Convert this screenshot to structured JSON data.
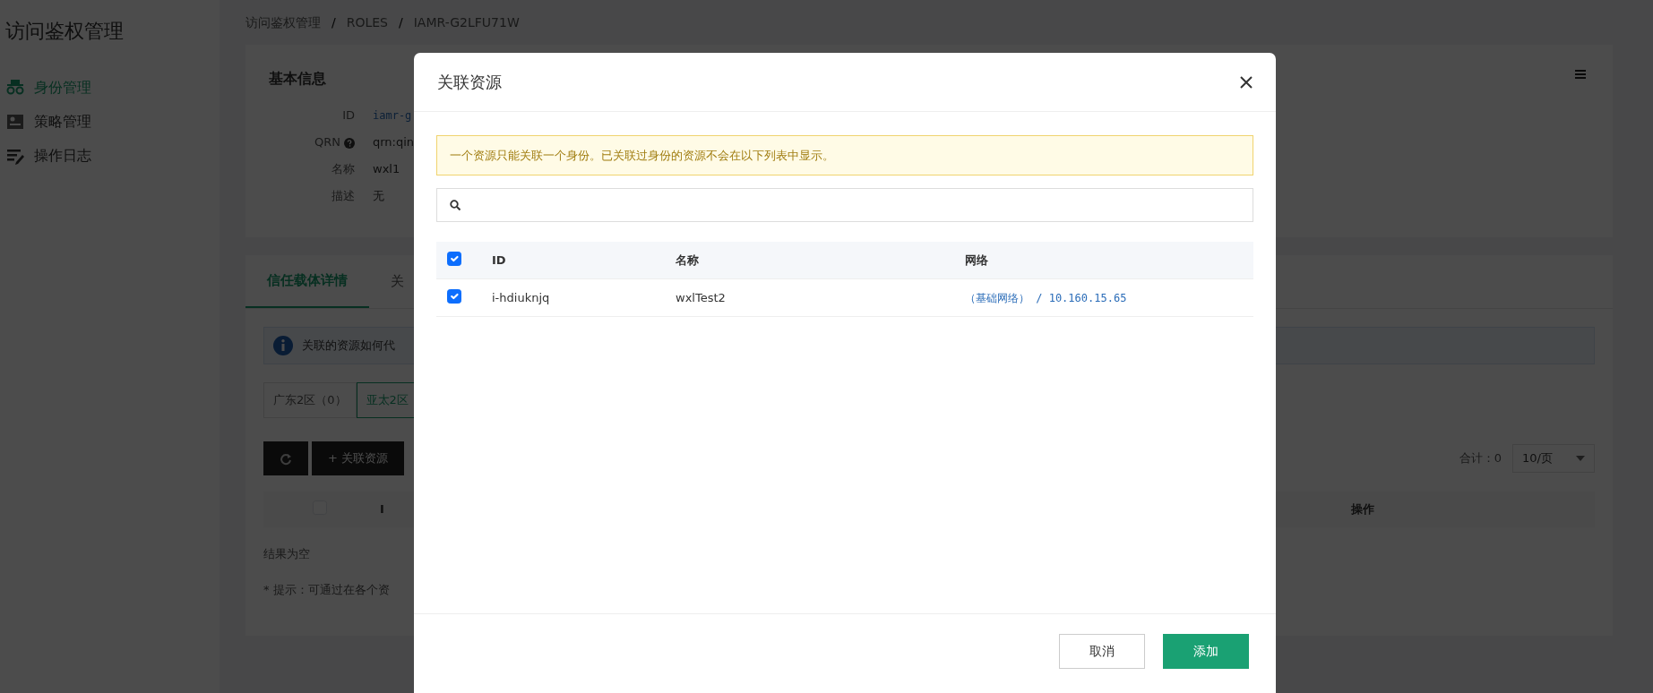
{
  "sidebar": {
    "title": "访问鉴权管理",
    "items": [
      {
        "label": "身份管理",
        "kind": "identity",
        "selected": true
      },
      {
        "label": "策略管理",
        "kind": "policy",
        "selected": false
      },
      {
        "label": "操作日志",
        "kind": "log",
        "selected": false
      }
    ]
  },
  "breadcrumb": [
    {
      "text": "访问鉴权管理",
      "kind": "link"
    },
    {
      "text": "/",
      "kind": "separator"
    },
    {
      "text": "ROLES",
      "kind": "link"
    },
    {
      "text": "/",
      "kind": "separator"
    },
    {
      "text": "IAMR-G2LFU71W",
      "kind": "link"
    }
  ],
  "basic_info": {
    "title": "基本信息",
    "fields": [
      {
        "label": "ID",
        "value": "iamr-g",
        "kind": "mono",
        "help": false
      },
      {
        "label": "QRN",
        "value": "qrn:qin",
        "kind": "plain",
        "help": true
      },
      {
        "label": "名称",
        "value": "wxl1",
        "kind": "plain",
        "help": false
      },
      {
        "label": "描述",
        "value": "无",
        "kind": "plain",
        "help": false
      }
    ]
  },
  "tabs": [
    {
      "label": "信任载体详情",
      "selected": true
    },
    {
      "label": "关",
      "selected": false
    }
  ],
  "info_alert": "关联的资源如何代",
  "regions": [
    {
      "label": "广东2区（0）",
      "selected": false
    },
    {
      "label": "亚太2区",
      "selected": true
    }
  ],
  "toolbar": {
    "add_button": "+ 关联资源",
    "total": "合计：0",
    "page_size": "10/页"
  },
  "table": {
    "select_all_checked": false,
    "columns": [
      "I",
      "操作"
    ],
    "empty_text": "结果为空"
  },
  "hint": "* 提示：可通过在各个资",
  "modal": {
    "title": "关联资源",
    "warning": "一个资源只能关联一个身份。已关联过身份的资源不会在以下列表中显示。",
    "select_all_checked": true,
    "columns": [
      "ID",
      "名称",
      "网络"
    ],
    "rows": [
      {
        "checked": true,
        "id": "i-hdiuknjq",
        "name": "wxlTest2",
        "network": "（基础网络） / 10.160.15.65"
      }
    ],
    "buttons": [
      {
        "label": "取消",
        "kind": "secondary"
      },
      {
        "label": "添加",
        "kind": "primary"
      }
    ]
  }
}
